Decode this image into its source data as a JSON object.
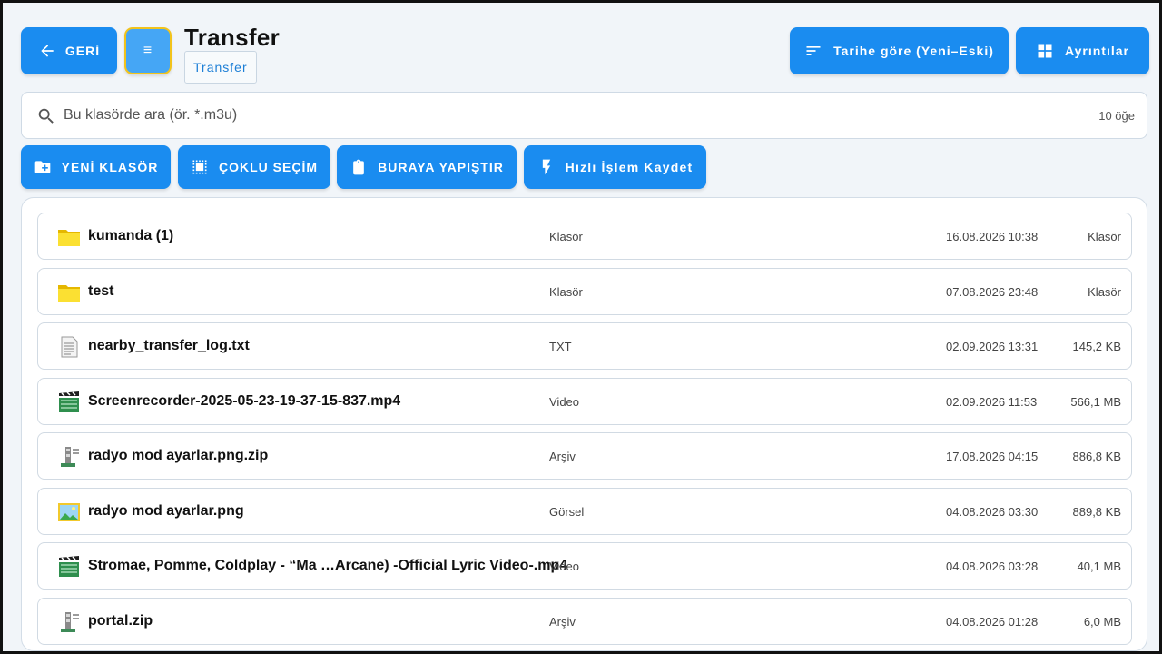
{
  "header": {
    "back_label": "GERİ",
    "menu_glyph": "≡",
    "title": "Transfer",
    "breadcrumb": "Transfer",
    "sort_label": "Tarihe göre (Yeni–Eski)",
    "details_label": "Ayrıntılar"
  },
  "search": {
    "placeholder": "Bu klasörde ara (ör. *.m3u)",
    "value": "",
    "count": "10 öğe"
  },
  "actions": {
    "new_folder": "YENİ KLASÖR",
    "multi_select": "ÇOKLU SEÇİM",
    "paste": "BURAYA YAPIŞTIR",
    "quick_action": "Hızlı İşlem Kaydet"
  },
  "colors": {
    "accent": "#1a8cf0",
    "menu_button": "#45a6f5",
    "menu_border": "#f2c31b",
    "background": "#f1f5f9",
    "folder": "#f7d21c"
  },
  "files": [
    {
      "name": "kumanda (1)",
      "type": "Klasör",
      "date": "16.08.2026 10:38",
      "size": "Klasör",
      "icon": "folder-icon"
    },
    {
      "name": "test",
      "type": "Klasör",
      "date": "07.08.2026 23:48",
      "size": "Klasör",
      "icon": "folder-icon"
    },
    {
      "name": "nearby_transfer_log.txt",
      "type": "TXT",
      "date": "02.09.2026 13:31",
      "size": "145,2 KB",
      "icon": "text-file-icon"
    },
    {
      "name": "Screenrecorder-2025-05-23-19-37-15-837.mp4",
      "type": "Video",
      "date": "02.09.2026 11:53",
      "size": "566,1 MB",
      "icon": "video-file-icon"
    },
    {
      "name": "radyo mod ayarlar.png.zip",
      "type": "Arşiv",
      "date": "17.08.2026 04:15",
      "size": "886,8 KB",
      "icon": "archive-file-icon"
    },
    {
      "name": "radyo mod ayarlar.png",
      "type": "Görsel",
      "date": "04.08.2026 03:30",
      "size": "889,8 KB",
      "icon": "image-file-icon"
    },
    {
      "name": "Stromae, Pomme, Coldplay - “Ma …Arcane) -Official Lyric Video-.mp4",
      "type": "Video",
      "date": "04.08.2026 03:28",
      "size": "40,1 MB",
      "icon": "video-file-icon"
    },
    {
      "name": "portal.zip",
      "type": "Arşiv",
      "date": "04.08.2026 01:28",
      "size": "6,0 MB",
      "icon": "archive-file-icon"
    }
  ]
}
